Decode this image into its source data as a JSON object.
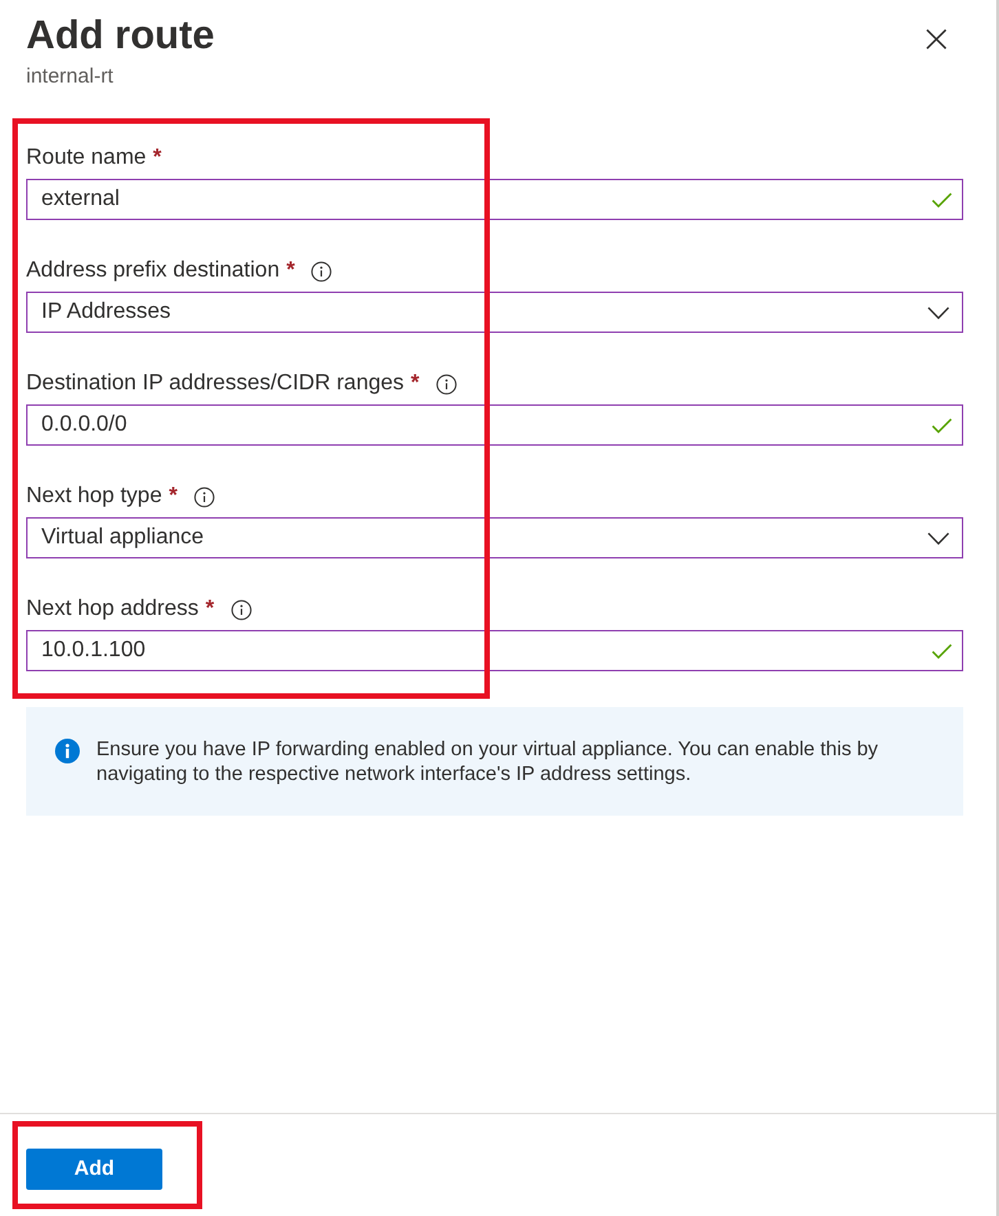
{
  "panel": {
    "title": "Add route",
    "subtitle": "internal-rt"
  },
  "form": {
    "highlighted": true,
    "fields": [
      {
        "kind": "text",
        "label": "Route name",
        "required_mark": "*",
        "value": "external",
        "valid": true
      },
      {
        "kind": "dropdown",
        "label": "Address prefix destination",
        "required_mark": "*",
        "info": true,
        "value": "IP Addresses"
      },
      {
        "kind": "text",
        "label": "Destination IP addresses/CIDR ranges",
        "required_mark": "*",
        "info": true,
        "value": "0.0.0.0/0",
        "valid": true
      },
      {
        "kind": "dropdown",
        "label": "Next hop type",
        "required_mark": "*",
        "info": true,
        "value": "Virtual appliance"
      },
      {
        "kind": "text",
        "label": "Next hop address",
        "required_mark": "*",
        "info": true,
        "value": "10.0.1.100",
        "valid": true
      }
    ]
  },
  "notice": {
    "kind": "info",
    "text": "Ensure you have IP forwarding enabled on your virtual appliance. You can enable this by navigating to the respective network interface's IP address settings."
  },
  "footer": {
    "highlighted": true,
    "buttons": [
      {
        "label": "Add",
        "kind": "primary"
      }
    ]
  }
}
